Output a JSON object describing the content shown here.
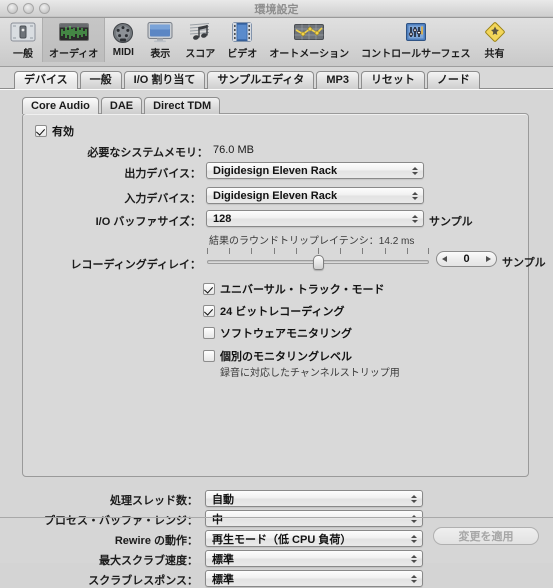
{
  "window": {
    "title": "環境設定",
    "traffic_lights": [
      "close-button",
      "minimize-button",
      "zoom-button"
    ]
  },
  "toolbar": {
    "items": [
      {
        "label": "一般",
        "icon": "general-icon",
        "selected": false
      },
      {
        "label": "オーディオ",
        "icon": "audio-waveform-icon",
        "selected": true
      },
      {
        "label": "MIDI",
        "icon": "midi-port-icon",
        "selected": false
      },
      {
        "label": "表示",
        "icon": "display-monitor-icon",
        "selected": false
      },
      {
        "label": "スコア",
        "icon": "score-notes-icon",
        "selected": false
      },
      {
        "label": "ビデオ",
        "icon": "video-film-icon",
        "selected": false
      },
      {
        "label": "オートメーション",
        "icon": "automation-curve-icon",
        "selected": false
      },
      {
        "label": "コントロールサーフェス",
        "icon": "control-surface-icon",
        "selected": false
      },
      {
        "label": "共有",
        "icon": "sharing-diamond-icon",
        "selected": false
      }
    ]
  },
  "tabs": {
    "items": [
      {
        "label": "デバイス",
        "selected": true
      },
      {
        "label": "一般",
        "selected": false
      },
      {
        "label": "I/O 割り当て",
        "selected": false
      },
      {
        "label": "サンプルエディタ",
        "selected": false
      },
      {
        "label": "MP3",
        "selected": false
      },
      {
        "label": "リセット",
        "selected": false
      },
      {
        "label": "ノード",
        "selected": false
      }
    ]
  },
  "subtabs": {
    "items": [
      {
        "label": "Core Audio",
        "selected": true
      },
      {
        "label": "DAE",
        "selected": false
      },
      {
        "label": "Direct TDM",
        "selected": false
      }
    ]
  },
  "core_audio": {
    "enabled_checkbox": {
      "label": "有効",
      "checked": true
    },
    "system_memory": {
      "label": "必要なシステムメモリ：",
      "value": "76.0 MB"
    },
    "output_device": {
      "label": "出力デバイス：",
      "value": "Digidesign Eleven Rack"
    },
    "input_device": {
      "label": "入力デバイス：",
      "value": "Digidesign Eleven Rack"
    },
    "io_buffer": {
      "label": "I/O バッファサイズ：",
      "value": "128",
      "unit": "サンプル"
    },
    "latency_hint": "結果のラウンドトリップレイテンシ：14.2 ms",
    "recording_delay": {
      "label": "レコーディングディレイ：",
      "value": "0",
      "unit": "サンプル",
      "min": -5000,
      "max": 5000,
      "tick_count": 11,
      "knob_percent": 50
    },
    "options": [
      {
        "label": "ユニバーサル・トラック・モード",
        "checked": true
      },
      {
        "label": "24 ビットレコーディング",
        "checked": true
      },
      {
        "label": "ソフトウェアモニタリング",
        "checked": false
      },
      {
        "label": "個別のモニタリングレベル",
        "checked": false
      }
    ],
    "options_sub_hint": "録音に対応したチャンネルストリップ用"
  },
  "advanced": {
    "rows": [
      {
        "label": "処理スレッド数：",
        "value": "自動"
      },
      {
        "label": "プロセス・バッファ・レンジ：",
        "value": "中"
      },
      {
        "label": "Rewire の動作：",
        "value": "再生モード（低 CPU 負荷）"
      },
      {
        "label": "最大スクラブ速度：",
        "value": "標準"
      },
      {
        "label": "スクラブレスポンス：",
        "value": "標準"
      }
    ]
  },
  "footer": {
    "apply_button": {
      "label": "変更を適用",
      "disabled": true
    }
  },
  "colors": {
    "window_bg": "#d8d8d8",
    "pane_bg": "#d6d6d6",
    "group_bg": "#d9d9d9",
    "border": "#9a9a9a",
    "text": "#1b1b1b",
    "disabled_text": "#a6a6a6",
    "selected_tab": "#c6c6c6"
  }
}
